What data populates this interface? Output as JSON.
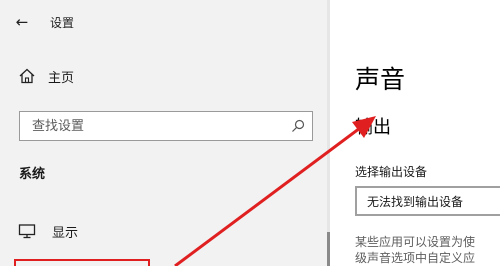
{
  "window": {
    "title": "设置"
  },
  "sidebar": {
    "home_label": "主页",
    "search": {
      "placeholder": "查找设置"
    },
    "section_title": "系统",
    "items": [
      {
        "label": "显示",
        "icon": "monitor-icon"
      }
    ]
  },
  "main": {
    "page_title": "声音",
    "subsection_title": "输出",
    "device_label": "选择输出设备",
    "device_select": {
      "value": "无法找到输出设备"
    },
    "description_lines": [
      "某些应用可以设置为使",
      "级声音选项中自定义应"
    ]
  },
  "annotations": {
    "arrow_color": "#e02020",
    "highlight_color": "#e02020"
  }
}
